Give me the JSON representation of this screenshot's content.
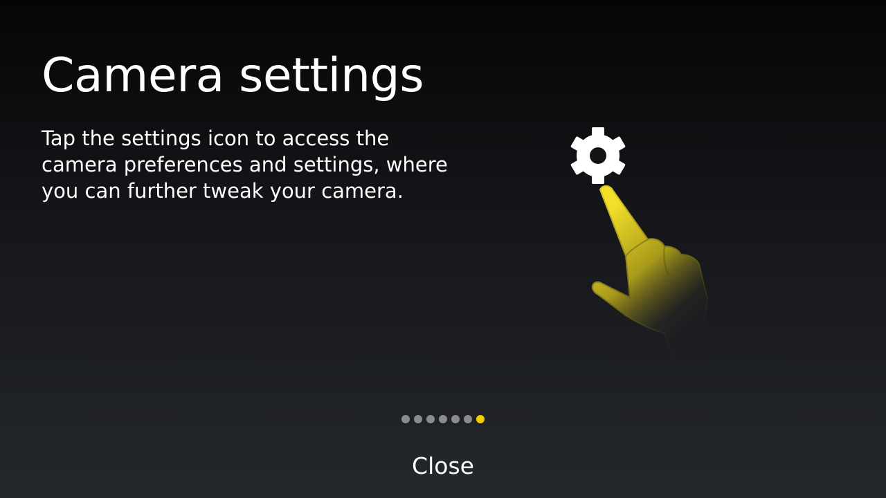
{
  "screen": {
    "title": "Camera settings",
    "description": "Tap the settings icon to access the camera preferences and settings, where you can further tweak your camera."
  },
  "illustration": {
    "icons": [
      "gear-icon",
      "pointing-hand-icon"
    ],
    "accent_color": "#f3cf00"
  },
  "pager": {
    "total_pages": 7,
    "current_page": 7,
    "dot_color": "#8a8c90",
    "active_dot_color": "#f3cf00"
  },
  "footer": {
    "close_label": "Close"
  }
}
